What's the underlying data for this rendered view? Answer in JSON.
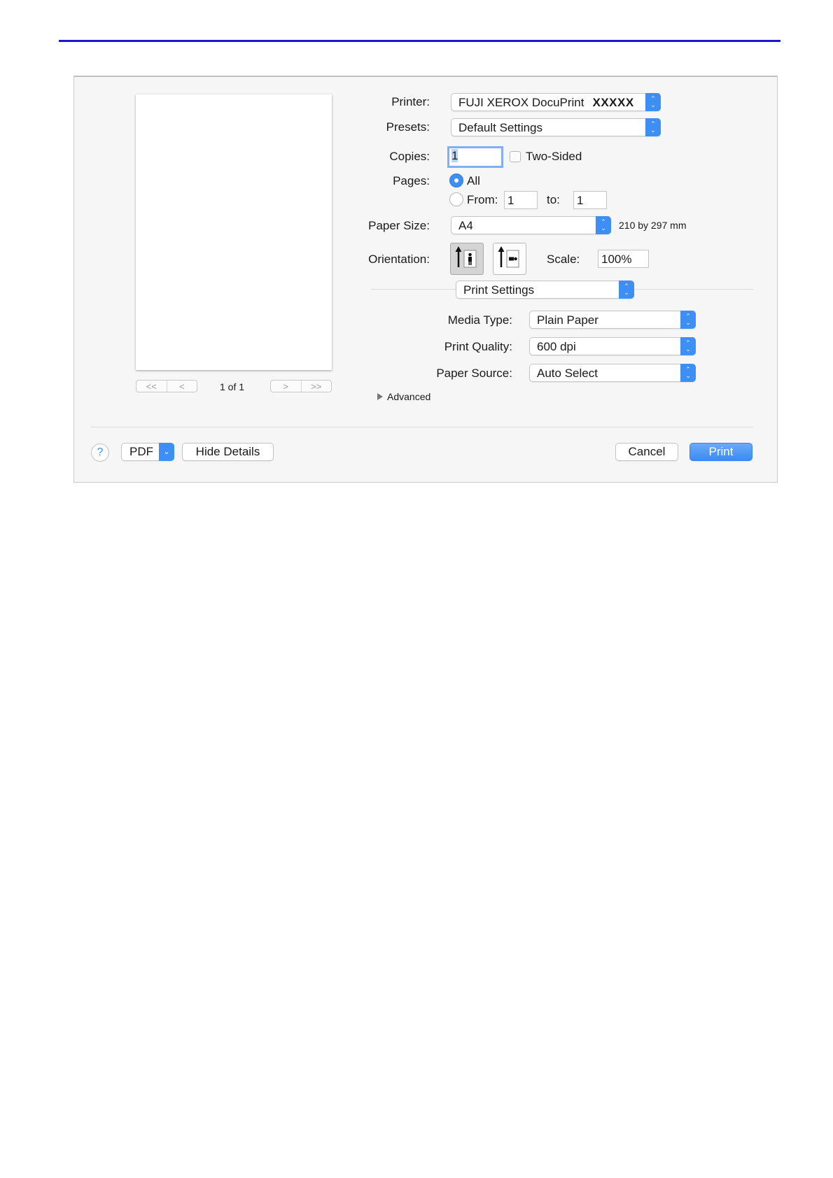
{
  "preview": {
    "page_indicator": "1 of 1",
    "nav": {
      "first": "<<",
      "prev": "<",
      "next": ">",
      "last": ">>"
    }
  },
  "printer": {
    "label": "Printer:",
    "value": "FUJI XEROX DocuPrint",
    "model": "XXXXX"
  },
  "presets": {
    "label": "Presets:",
    "value": "Default Settings"
  },
  "copies": {
    "label": "Copies:",
    "value": "1",
    "two_sided_label": "Two-Sided",
    "two_sided_checked": false
  },
  "pages": {
    "label": "Pages:",
    "all_label": "All",
    "from_label": "From:",
    "from_value": "1",
    "to_label": "to:",
    "to_value": "1",
    "selected": "All"
  },
  "paper_size": {
    "label": "Paper Size:",
    "value": "A4",
    "dimensions": "210 by 297 mm"
  },
  "orientation": {
    "label": "Orientation:",
    "selected": "portrait"
  },
  "scale": {
    "label": "Scale:",
    "value": "100%"
  },
  "section_popup": {
    "value": "Print Settings"
  },
  "media_type": {
    "label": "Media Type:",
    "value": "Plain Paper"
  },
  "print_quality": {
    "label": "Print Quality:",
    "value": "600 dpi"
  },
  "paper_source": {
    "label": "Paper Source:",
    "value": "Auto Select"
  },
  "advanced": {
    "label": "Advanced"
  },
  "footer": {
    "help": "?",
    "pdf_label": "PDF",
    "hide_details_label": "Hide Details",
    "cancel_label": "Cancel",
    "print_label": "Print"
  },
  "colors": {
    "accent": "#3d8ef5",
    "rule": "#1a1acc",
    "dialog_bg": "#f6f6f6"
  }
}
